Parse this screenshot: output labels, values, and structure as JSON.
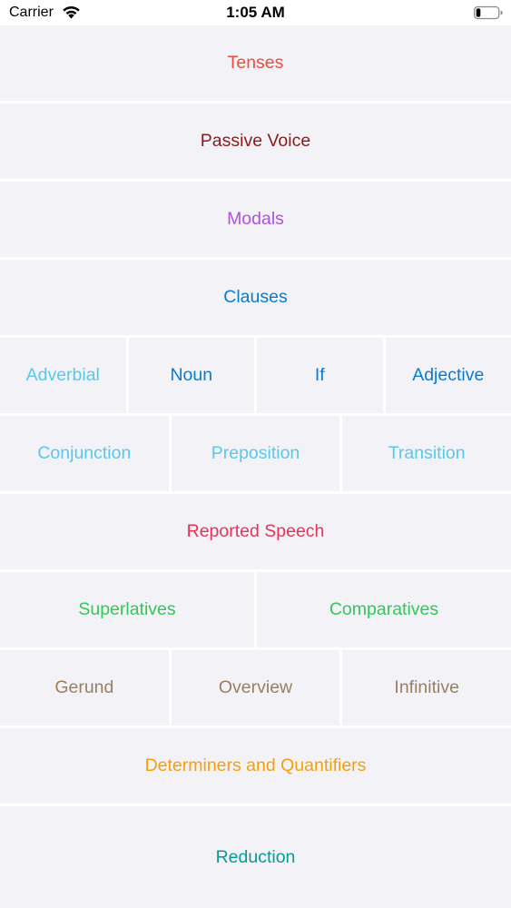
{
  "status_bar": {
    "carrier": "Carrier",
    "time": "1:05 AM",
    "wifi_icon": "wifi-icon",
    "battery_icon": "battery-icon",
    "battery_level": 0.2
  },
  "rows": [
    {
      "cells": [
        {
          "label": "Tenses",
          "color": "#ef4b3c"
        }
      ]
    },
    {
      "cells": [
        {
          "label": "Passive Voice",
          "color": "#8b1a1a"
        }
      ]
    },
    {
      "cells": [
        {
          "label": "Modals",
          "color": "#af52de"
        }
      ]
    },
    {
      "cells": [
        {
          "label": "Clauses",
          "color": "#0a7bd1"
        }
      ]
    },
    {
      "cells": [
        {
          "label": "Adverbial",
          "color": "#5ac8ea"
        },
        {
          "label": "Noun",
          "color": "#0a7bd1"
        },
        {
          "label": "If",
          "color": "#0a7bd1"
        },
        {
          "label": "Adjective",
          "color": "#0a7bd1"
        }
      ]
    },
    {
      "cells": [
        {
          "label": "Conjunction",
          "color": "#5ac8ea"
        },
        {
          "label": "Preposition",
          "color": "#5ac8ea"
        },
        {
          "label": "Transition",
          "color": "#5ac8ea"
        }
      ]
    },
    {
      "cells": [
        {
          "label": "Reported Speech",
          "color": "#e8325a"
        }
      ]
    },
    {
      "cells": [
        {
          "label": "Superlatives",
          "color": "#34c759"
        },
        {
          "label": "Comparatives",
          "color": "#34c759"
        }
      ]
    },
    {
      "cells": [
        {
          "label": "Gerund",
          "color": "#9a7f63"
        },
        {
          "label": "Overview",
          "color": "#9a7f63"
        },
        {
          "label": "Infinitive",
          "color": "#9a7f63"
        }
      ]
    },
    {
      "cells": [
        {
          "label": "Determiners and Quantifiers",
          "color": "#f5a00a"
        }
      ]
    },
    {
      "cells": [
        {
          "label": "Reduction",
          "color": "#0a9a94"
        }
      ]
    }
  ]
}
